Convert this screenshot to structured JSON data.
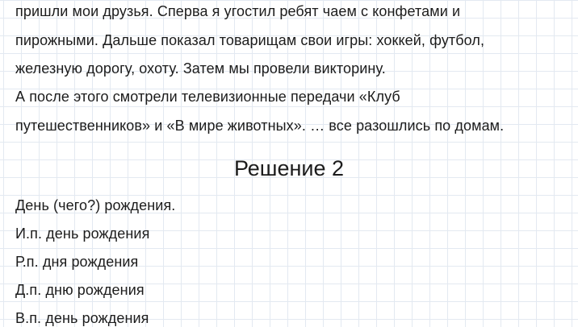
{
  "passage": {
    "lines": [
      "пришли мои друзья. Сперва я угостил ребят чаем с конфетами и",
      "пирожными. Дальше показал товарищам свои игры: хоккей, футбол,",
      "железную дорогу, охоту. Затем мы провели викторину.",
      "А после этого смотрели телевизионные передачи «Клуб",
      "путешественников» и «В мире животных». … все разошлись по домам."
    ]
  },
  "solution": {
    "title": "Решение 2",
    "lines": [
      "День (чего?) рождения.",
      "И.п. день рождения",
      "Р.п. дня рождения",
      "Д.п. дню рождения",
      "В.п. день рождения"
    ]
  }
}
